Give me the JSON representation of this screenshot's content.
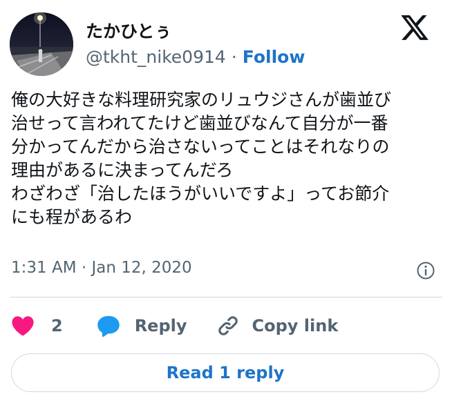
{
  "author": {
    "display_name": "たかひとぅ",
    "handle": "@tkht_nike0914",
    "separator": "·",
    "follow_label": "Follow"
  },
  "brand": {
    "logo_icon": "x-logo-icon"
  },
  "post": {
    "text": "俺の大好きな料理研究家のリュウジさんが歯並び\n治せって言われてたけど歯並びなんて自分が一番\n分かってんだから治さないってことはそれなりの\n理由があるに決まってんだろ\nわざわざ「治したほうがいいですよ」ってお節介\nにも程があるわ",
    "timestamp": "1:31 AM · Jan 12, 2020"
  },
  "actions": {
    "like_count": "2",
    "reply_label": "Reply",
    "copy_link_label": "Copy link"
  },
  "read_replies_label": "Read 1 reply",
  "colors": {
    "link_blue": "#1d74c9",
    "heart_pink": "#f91880",
    "reply_bubble_blue": "#1d9bf0",
    "secondary_text": "#536471",
    "primary_text": "#0f1419",
    "border": "#cfd9de"
  }
}
